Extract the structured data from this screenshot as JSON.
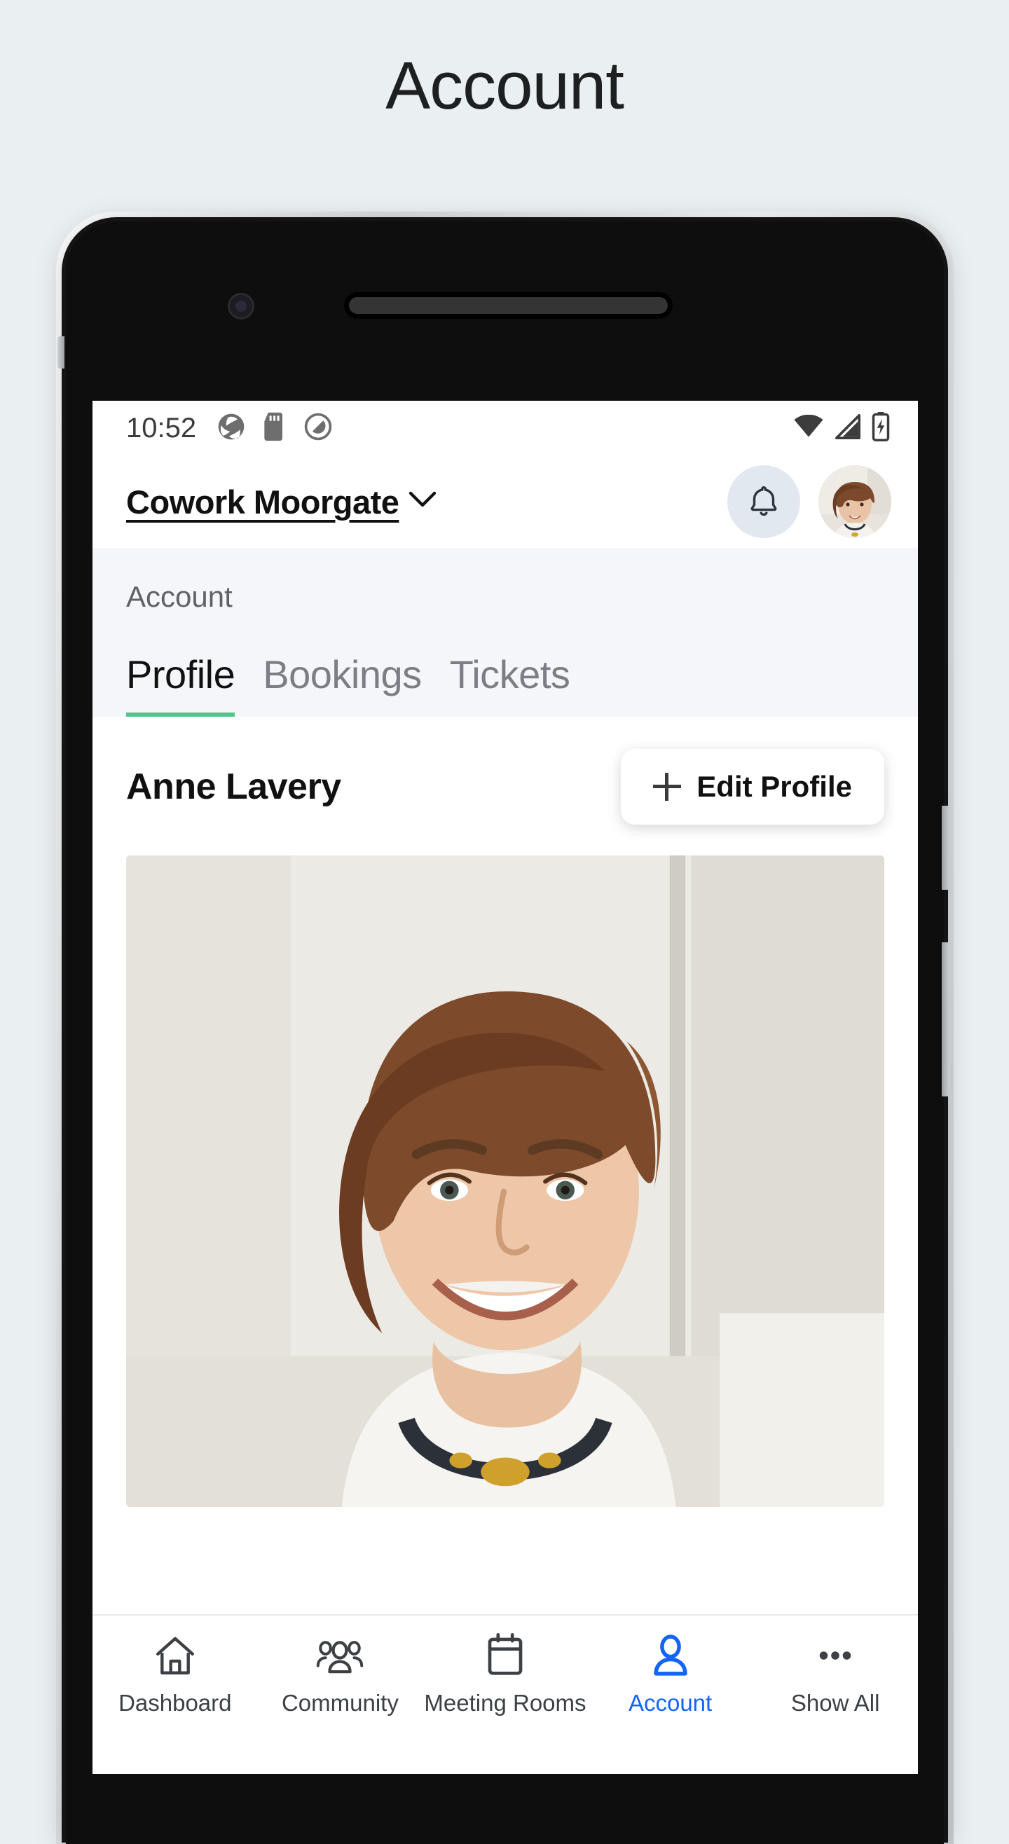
{
  "page": {
    "title": "Account",
    "background_color": "#eaeff2"
  },
  "status_bar": {
    "time": "10:52",
    "left_icons": [
      "app-sync-icon",
      "sd-card-icon",
      "do-not-disturb-icon"
    ],
    "right_icons": [
      "wifi-icon",
      "cellular-signal-icon",
      "battery-charging-icon"
    ]
  },
  "app_bar": {
    "location_name": "Cowork Moorgate",
    "location_chevron": "chevron-down-icon",
    "notifications_icon": "bell-icon",
    "avatar": "user-avatar"
  },
  "section": {
    "label": "Account",
    "tabs": [
      {
        "label": "Profile",
        "active": true
      },
      {
        "label": "Bookings",
        "active": false
      },
      {
        "label": "Tickets",
        "active": false
      }
    ],
    "active_tab_underline_color": "#4cc98a"
  },
  "profile": {
    "name": "Anne Lavery",
    "edit_button_label": "Edit Profile",
    "edit_button_icon": "plus-icon",
    "photo_alt": "profile-photo"
  },
  "bottom_nav": {
    "active_color": "#1464f6",
    "items": [
      {
        "label": "Dashboard",
        "icon": "home-icon",
        "active": false
      },
      {
        "label": "Community",
        "icon": "people-icon",
        "active": false
      },
      {
        "label": "Meeting Rooms",
        "icon": "calendar-icon",
        "active": false
      },
      {
        "label": "Account",
        "icon": "person-icon",
        "active": true
      },
      {
        "label": "Show All",
        "icon": "ellipsis-icon",
        "active": false
      }
    ]
  }
}
